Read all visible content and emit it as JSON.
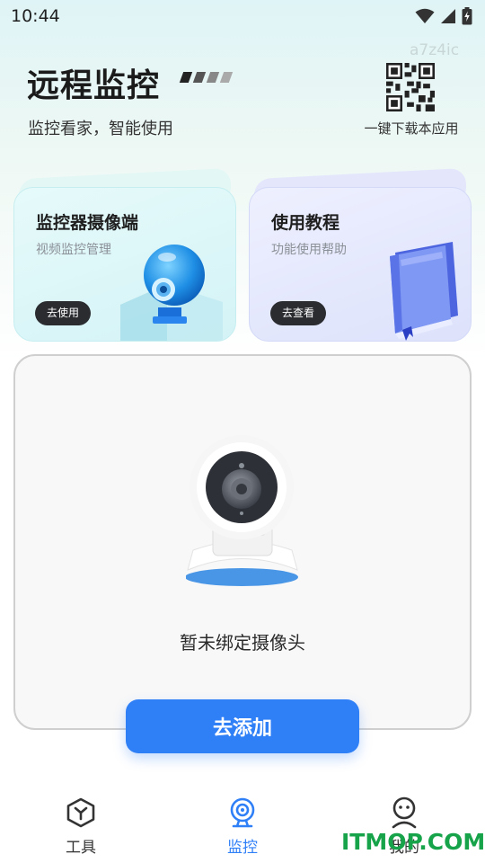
{
  "status_bar": {
    "time": "10:44"
  },
  "watermark": "a7z4ic",
  "header": {
    "title": "远程监控",
    "subtitle": "监控看家，智能使用",
    "qr_label": "一键下载本应用"
  },
  "cards": {
    "camera": {
      "title": "监控器摄像端",
      "desc": "视频监控管理",
      "button": "去使用"
    },
    "guide": {
      "title": "使用教程",
      "desc": "功能使用帮助",
      "button": "去查看"
    }
  },
  "device_panel": {
    "empty_text": "暂未绑定摄像头"
  },
  "add_button": "去添加",
  "bottom_nav": [
    {
      "label": "工具",
      "icon": "cube-icon",
      "active": false
    },
    {
      "label": "监控",
      "icon": "webcam-icon",
      "active": true
    },
    {
      "label": "我的",
      "icon": "face-icon",
      "active": false
    }
  ],
  "overlay_watermark": "ITMOP.COM",
  "colors": {
    "accent": "#2f7ff7",
    "nav_active": "#2f7ff7",
    "nav_inactive": "#333333",
    "dark_button": "#2a2c30",
    "watermark_green": "#17a34a"
  }
}
